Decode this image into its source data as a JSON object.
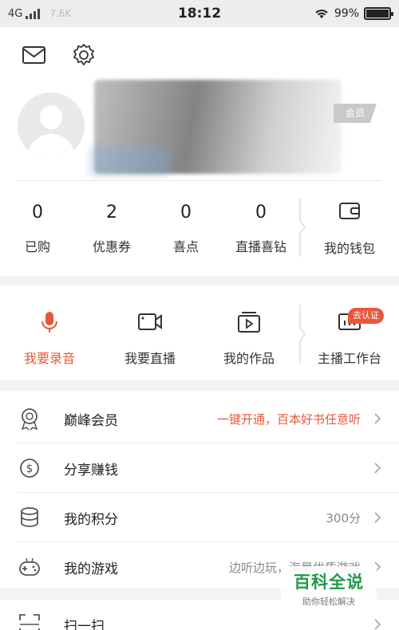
{
  "status_bar": {
    "network": "4G",
    "faded": "7.6K",
    "time": "18:12",
    "battery": "99%"
  },
  "profile": {
    "vip_badge": "会员"
  },
  "stats": [
    {
      "value": "0",
      "label": "已购"
    },
    {
      "value": "2",
      "label": "优惠券"
    },
    {
      "value": "0",
      "label": "喜点"
    },
    {
      "value": "0",
      "label": "直播喜钻"
    }
  ],
  "wallet": {
    "label": "我的钱包"
  },
  "create": [
    {
      "label": "我要录音"
    },
    {
      "label": "我要直播"
    },
    {
      "label": "我的作品"
    },
    {
      "label": "主播工作台",
      "badge": "去认证"
    }
  ],
  "menu": [
    {
      "title": "巅峰会员",
      "hint": "一键开通，百本好书任意听"
    },
    {
      "title": "分享赚钱",
      "hint": ""
    },
    {
      "title": "我的积分",
      "hint": "300分"
    },
    {
      "title": "我的游戏",
      "hint": "边听边玩，海量优质游戏"
    },
    {
      "title": "扫一扫",
      "hint": ""
    }
  ],
  "watermark": {
    "title": "百科全说",
    "subtitle": "助你轻松解决"
  },
  "colors": {
    "accent": "#e8573b",
    "page_bg": "#f3f3f5",
    "watermark": "#1f9a48"
  }
}
